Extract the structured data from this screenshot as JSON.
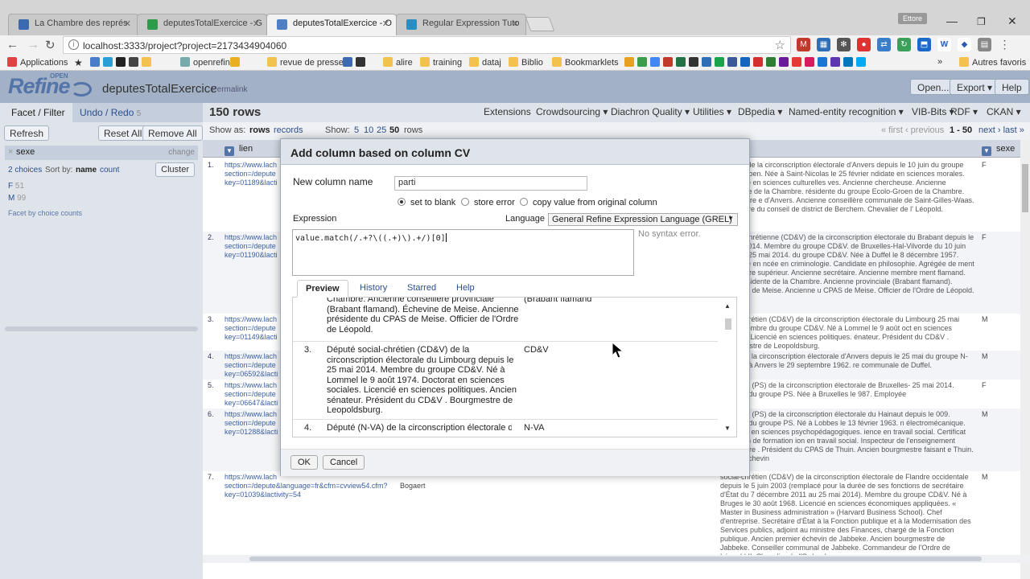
{
  "browser": {
    "tabs": [
      {
        "title": "La Chambre des représ",
        "color": "#3b6ab0"
      },
      {
        "title": "deputesTotalExercice - G",
        "color": "#2c9c4a"
      },
      {
        "title": "deputesTotalExercice - O",
        "color": "#4f7fc4"
      },
      {
        "title": "Regular Expression Tuto",
        "color": "#2a8fc0"
      }
    ],
    "profile_label": "Ettore",
    "url": "localhost:3333/project?project=2173434904060",
    "bookmarks": [
      {
        "label": "Applications",
        "kind": "apps"
      },
      {
        "label": "openrefine",
        "kind": "folder"
      },
      {
        "label": "revue de presse",
        "kind": "folder"
      },
      {
        "label": "alire",
        "kind": "folder"
      },
      {
        "label": "training",
        "kind": "folder"
      },
      {
        "label": "dataj",
        "kind": "folder"
      },
      {
        "label": "Biblio",
        "kind": "folder"
      },
      {
        "label": "Bookmarklets",
        "kind": "folder"
      },
      {
        "label": "Autres favoris",
        "kind": "folder"
      }
    ],
    "overflow": "»"
  },
  "header": {
    "logo": "Refine",
    "logo_open": "OPEN",
    "project_name": "deputesTotalExercice",
    "permalink": "Permalink",
    "buttons": [
      "Open...",
      "Export ▾",
      "Help"
    ]
  },
  "left": {
    "tab_facet": "Facet / Filter",
    "tab_undo": "Undo / Redo",
    "undo_count": "5",
    "refresh": "Refresh",
    "reset_all": "Reset All",
    "remove_all": "Remove All",
    "facet": {
      "close": "×",
      "name": "sexe",
      "change": "change",
      "choices_label": "2 choices",
      "sort_by": "Sort by:",
      "sort_name": "name",
      "sort_count": "count",
      "cluster": "Cluster",
      "choices": [
        {
          "name": "F",
          "count": "51"
        },
        {
          "name": "M",
          "count": "99"
        }
      ],
      "facet_by_counts": "Facet by choice counts"
    }
  },
  "view": {
    "rows_title": "150 rows",
    "menus": [
      "Extensions",
      "Crowdsourcing ▾",
      "Diachron Quality ▾",
      "Utilities ▾",
      "DBpedia ▾",
      "Named-entity recognition ▾",
      "VIB-Bits ▾",
      "RDF ▾",
      "CKAN ▾"
    ],
    "show_as": "Show as:",
    "rows": "rows",
    "records": "records",
    "show": "Show:",
    "page_sizes": [
      "5",
      "10",
      "25",
      "50"
    ],
    "show_rows": "rows",
    "pager": "« first  ‹ previous",
    "pager_range": "1 - 50",
    "pager_next": "next ›  last »",
    "col_lien": "lien",
    "col_sexe": "sexe",
    "rows_data": [
      {
        "n": "1.",
        "lien": "https://www.lach section=/depute key=01189&lacti",
        "cv": "(Groen) de la circonscription électorale d'Anvers depuis le 10 juin du groupe Ecolo-Groen. Née à Saint-Nicolas le 25 février ndidate en sciences morales. Licenciée en sciences culturelles ves. Ancienne chercheuse. Ancienne secrétaire de la Chambre. résidente du groupe Ecolo-Groen de la Chambre. Conseillère e d'Anvers. Ancienne conseillère communale de Saint-Gilles-Waas. conseillère du conseil de district de Berchem. Chevalier de l' Léopold.",
        "sexe": "F"
      },
      {
        "n": "2.",
        "lien": "https://www.lach section=/depute key=01190&lacti",
        "cv": "sociale-chrétienne (CD&V) de la circonscription électorale du Brabant depuis le 25 mai 2014. Membre du groupe CD&V. de Bruxelles-Hal-Vilvorde du 10 juin 2007 au 25 mai 2014. du groupe CD&V. Née à Duffel le 8 décembre 1957. Licenciée en ncée en criminologie. Candidate en philosophie. Agrégée de ment secondaire supérieur. Ancienne secrétaire. Ancienne membre ment flamand. Vice-présidente de la Chambre. Ancienne provinciale (Brabant flamand). Échevine de Meise. Ancienne u CPAS de Meise. Officier de l'Ordre de Léopold.",
        "sexe": "F"
      },
      {
        "n": "3.",
        "lien": "https://www.lach section=/depute key=01149&lacti",
        "cv": "social-chrétien (CD&V) de la circonscription électorale du Limbourg 25 mai 2014. Membre du groupe CD&V. Né à Lommel le 9 août oct en sciences sociales. Licencié en sciences politiques. énateur. Président du CD&V . Bourgmestre de Leopoldsburg.",
        "sexe": "M"
      },
      {
        "n": "4.",
        "lien": "https://www.lach section=/depute key=06592&lacti",
        "cv": "N-VA) de la circonscription électorale d'Anvers depuis le 25 mai du groupe N-VA. Née à Anvers le 29 septembre 1962. re communale de Duffel.",
        "sexe": "M"
      },
      {
        "n": "5.",
        "lien": "https://www.lach section=/depute key=06647&lacti",
        "cv": "socialiste (PS) de la circonscription électorale de Bruxelles- 25 mai 2014. Membre du groupe PS. Née à Bruxelles le 987. Employée",
        "sexe": "F"
      },
      {
        "n": "6.",
        "lien": "https://www.lach section=/depute key=01288&lacti",
        "cv": "socialiste (PS) de la circonscription électorale du Hainaut depuis le 009. Membre du groupe PS. Né à Lobbes le 13 février 1963. n électromécanique. Candidat en sciences psychopédagogiques. ience en travail social. Certificat européen de formation ion en travail social. Inspecteur de l'enseignement secondaire . Président du CPAS de Thuin. Ancien bourgmestre faisant e Thuin. Ancien échevin",
        "sexe": "M"
      },
      {
        "n": "7.",
        "lien": "https://www.lach section=/depute&language=fr&cfm=cvview54.cfm? key=01039&lactivity=54",
        "extra": "Bogaert",
        "cv": "social-chrétien (CD&V) de la circonscription électorale de Flandre occidentale depuis le 5 juin 2003 (remplacé pour la durée de ses fonctions de secrétaire d'État du 7 décembre 2011 au 25 mai 2014). Membre du groupe CD&V. Né à Bruges le 30 août 1968. Licencié en sciences économiques appliquées. « Master in Business administration » (Harvard Business School). Chef d'entreprise. Secrétaire d'État à la Fonction publique et à la Modernisation des Services publics, adjoint au ministre des Finances, chargé de la Fonction publique. Ancien premier échevin de Jabbeke. Ancien bourgmestre de Jabbeke. Conseiller communal de Jabbeke. Commandeur de l'Ordre de Léopold II. Chevalier de l'Ordre de",
        "sexe": "M"
      }
    ]
  },
  "dialog": {
    "title": "Add column based on column CV",
    "new_col_label": "New column name",
    "new_col_value": "parti",
    "on_error_options": [
      "set to blank",
      "store error",
      "copy value from original column"
    ],
    "selected_option": "set to blank",
    "expression_label": "Expression",
    "language_label": "Language",
    "language_value": "General Refine Expression Language (GREL)",
    "expression": "value.match(/.+?\\((.+)\\).+/)[0]",
    "syntax_status": "No syntax error.",
    "tabs": [
      "Preview",
      "History",
      "Starred",
      "Help"
    ],
    "preview_rows": [
      {
        "idx": "",
        "src": "Chambre. Ancienne conseillère provinciale (Brabant flamand). Échevine de Meise. Ancienne présidente du CPAS de Meise. Officier de l'Ordre de Léopold.",
        "res": "(Brabant flamand"
      },
      {
        "idx": "3.",
        "src": "Député social-chrétien (CD&V) de la circonscription électorale du Limbourg depuis le 25 mai 2014. Membre du groupe CD&V. Né à Lommel le 9 août 1974. Doctorat en sciences sociales. Licencié en sciences politiques. Ancien sénateur. Président du CD&V . Bourgmestre de Leopoldsburg.",
        "res": "CD&V"
      },
      {
        "idx": "4.",
        "src": "Député (N-VA) de la circonscription électorale d",
        "res": "N-VA"
      }
    ],
    "ok": "OK",
    "cancel": "Cancel"
  }
}
